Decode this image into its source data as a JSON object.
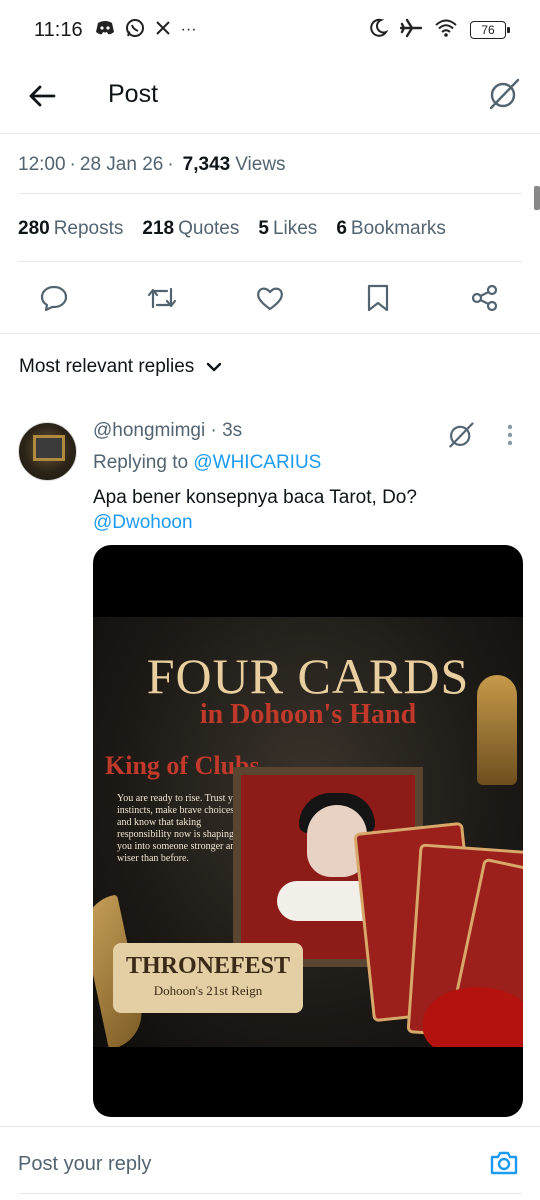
{
  "status_bar": {
    "time": "11:16",
    "left_icons": [
      "discord-icon",
      "whatsapp-icon",
      "x-icon",
      "more-dots-icon"
    ],
    "more_dots": "···",
    "right_icons": [
      "moon-icon",
      "airplane-icon",
      "wifi-icon"
    ],
    "battery": "76"
  },
  "header": {
    "title": "Post"
  },
  "meta": {
    "time": "12:00",
    "date": "28 Jan 26",
    "views_count": "7,343",
    "views_label": "Views",
    "separator": "·"
  },
  "stats": [
    {
      "count": "280",
      "label": "Reposts"
    },
    {
      "count": "218",
      "label": "Quotes"
    },
    {
      "count": "5",
      "label": "Likes"
    },
    {
      "count": "6",
      "label": "Bookmarks"
    }
  ],
  "actions": [
    "reply-icon",
    "repost-icon",
    "like-icon",
    "bookmark-icon",
    "share-icon"
  ],
  "replies": {
    "sort_label": "Most relevant replies"
  },
  "reply": {
    "handle": "@hongmimgi",
    "time_ago": "3s",
    "separator": "·",
    "replying_label": "Replying to",
    "replying_to": "@WHICARIUS",
    "text": "Apa bener konsepnya baca Tarot, Do?",
    "mention": "@Dwohoon",
    "media": {
      "title": "FOUR CARDS",
      "subtitle": "in Dohoon's Hand",
      "card_name": "King of Clubs",
      "description": "You are ready to rise. Trust your instincts, make brave choices, and know that taking responsibility now is shaping you into someone stronger and wiser than before.",
      "scroll_title": "THRONEFEST",
      "scroll_subtitle": "Dohoon's 21st Reign"
    }
  },
  "composer": {
    "placeholder": "Post your reply"
  },
  "colors": {
    "accent": "#1d9bf0",
    "text_primary": "#0f1419",
    "text_secondary": "#536471",
    "divider": "#e6e9ec"
  }
}
